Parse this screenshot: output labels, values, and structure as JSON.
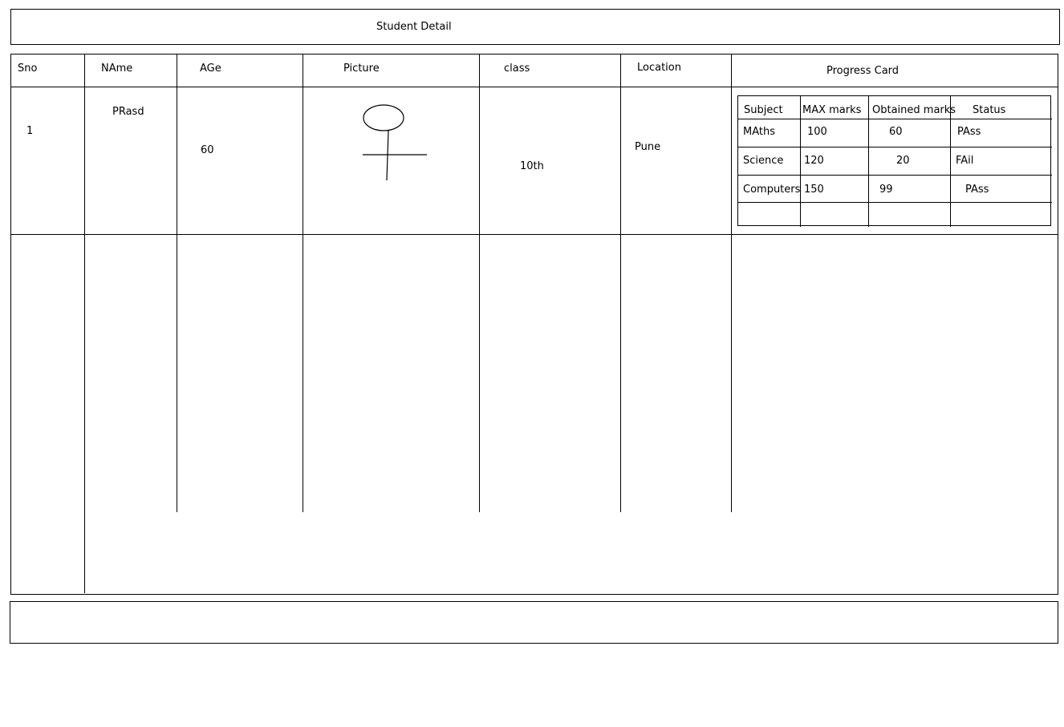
{
  "header": {
    "title": "Student Detail"
  },
  "table": {
    "columns": [
      "Sno",
      "NAme",
      "AGe",
      "Picture",
      "class",
      "Location",
      "Progress Card"
    ],
    "rows": [
      {
        "sno": "1",
        "name": "PRasd",
        "age": "60",
        "picture": "person-sketch",
        "class": "10th",
        "location": "Pune"
      }
    ]
  },
  "progress_card": {
    "headers": [
      "Subject",
      "MAX marks",
      "Obtained marks",
      "Status"
    ],
    "rows": [
      [
        "MAths",
        "100",
        "60",
        "PAss"
      ],
      [
        "Science",
        "120",
        "20",
        "FAil"
      ],
      [
        "Computers",
        "150",
        "99",
        "PAss"
      ]
    ]
  },
  "footer": {
    "text": ""
  }
}
